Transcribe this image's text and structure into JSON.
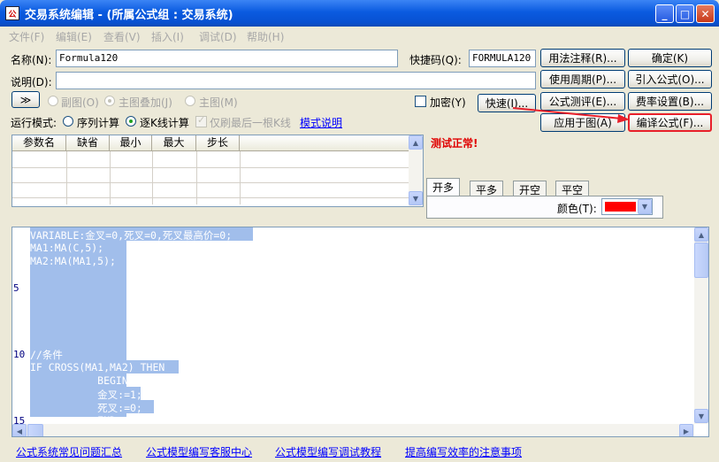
{
  "window": {
    "title": "交易系统编辑 - (所属公式组 : 交易系统)",
    "app_icon": "formula-app-icon",
    "minimize": "_",
    "maximize": "□",
    "close": "✕"
  },
  "menu": [
    "文件(F)",
    "编辑(E)",
    "查看(V)",
    "插入(I)",
    "调试(D)",
    "帮助(H)"
  ],
  "form": {
    "name_label": "名称(N):",
    "name_value": "Formula120",
    "shortcut_label": "快捷码(Q):",
    "shortcut_value": "FORMULA120",
    "desc_label": "说明(D):",
    "desc_value": "",
    "expand_btn": "≫",
    "sub_chart": "副图(O)",
    "main_overlay": "主图叠加(J)",
    "main_chart": "主图(M)",
    "encrypt": "加密(Y)",
    "quick_btn": "快速(I)...",
    "run_mode_label": "运行模式:",
    "seq_calc": "序列计算",
    "kline_calc": "逐K线计算",
    "refresh_last_only": "仅刷最后一根K线",
    "mode_help": "模式说明"
  },
  "right_buttons": [
    "用法注释(R)...",
    "确定(K)",
    "使用周期(P)...",
    "引入公式(O)...",
    "公式测评(E)...",
    "费率设置(B)...",
    "应用于图(A)",
    "编译公式(F)..."
  ],
  "param_table": {
    "headers": [
      "参数名",
      "缺省",
      "最小",
      "最大",
      "步长"
    ]
  },
  "test_status": "测试正常!",
  "signal_tabs": [
    "开多",
    "平多",
    "开空",
    "平空"
  ],
  "color_label": "颜色(T):",
  "color_value": "#FF0000",
  "editor": {
    "line_numbers": [
      "5",
      "10",
      "15"
    ],
    "lines": [
      "VARIABLE:金叉=0,死叉=0,死叉最高价=0;",
      "MA1:MA(C,5);",
      "MA2:MA(MA1,5);",
      "",
      "",
      "",
      "",
      "",
      "",
      "//条件",
      "IF CROSS(MA1,MA2) THEN",
      "           BEGIN",
      "           金叉:=1;",
      "           死叉:=0;",
      "           END"
    ]
  },
  "footer_links": [
    "公式系统常见问题汇总",
    "公式模型编写客服中心",
    "公式模型编写调试教程",
    "提高编写效率的注意事项"
  ],
  "accent_colors": {
    "titlebar": "#0A5BE0",
    "selection": "#A1BEEB",
    "status_red": "#E00000",
    "arrow": "#E8202A"
  }
}
